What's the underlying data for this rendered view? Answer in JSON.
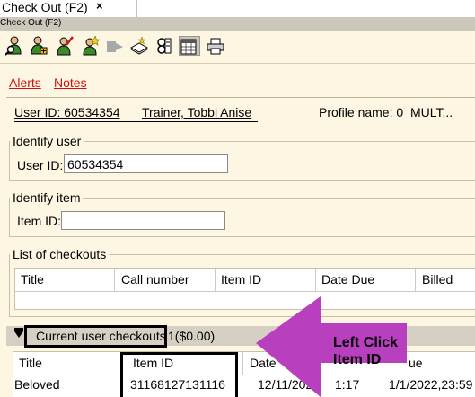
{
  "tab": {
    "label": "Check Out (F2)",
    "close": "×"
  },
  "window": {
    "title": "Check Out (F2)"
  },
  "toolbar": {
    "icons": [
      "patron-search-icon",
      "new-patron-icon",
      "patron-edit-icon",
      "patron-star-icon",
      "disabled-transfer-icon",
      "item-search-icon",
      "receipt-icon",
      "calendar-icon",
      "print-icon"
    ]
  },
  "links": {
    "alerts": "Alerts",
    "notes": "Notes"
  },
  "patron": {
    "user_id_line": "User ID: 60534354",
    "name": "Trainer, Tobbi Anise",
    "profile": "Profile name: 0_MULT..."
  },
  "identify_user": {
    "legend": "Identify user",
    "label": "User ID:",
    "value": "60534354"
  },
  "identify_item": {
    "legend": "Identify item",
    "label": "Item ID:",
    "value": ""
  },
  "checkouts_list": {
    "legend": "List of checkouts",
    "columns": [
      "Title",
      "Call number",
      "Item ID",
      "Date Due",
      "Billed"
    ]
  },
  "current_checkouts": {
    "label": "Current user checkouts",
    "summary": "1($0.00)",
    "columns": [
      "Title",
      "Item ID",
      "Date",
      "ue"
    ],
    "rows": [
      {
        "title": "Beloved",
        "item_id": "31168127131116",
        "date": "12/11/202",
        "time": "1:17",
        "due": "1/1/2022,23:59"
      }
    ]
  },
  "callout": {
    "text": "Left Click\nItem ID",
    "color": "#b83fbd"
  }
}
